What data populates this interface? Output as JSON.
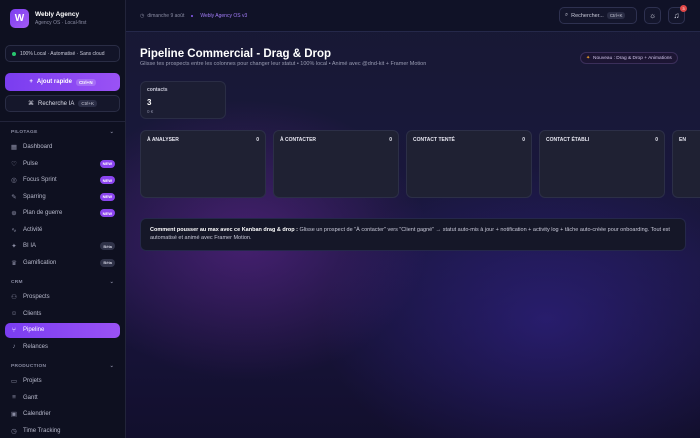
{
  "brand": {
    "name": "Webly Agency",
    "subtitle": "Agency OS · Local-first",
    "logo_letter": "W"
  },
  "local_badge": "100% Local · Automatisé · Sans cloud",
  "quick_add": {
    "label": "Ajout rapide",
    "shortcut": "Ctrl+N"
  },
  "ai_search": {
    "label": "Recherche IA",
    "shortcut": "Ctrl+K"
  },
  "sections": {
    "pilotage": "PILOTAGE",
    "crm": "CRM",
    "production": "PRODUCTION"
  },
  "nav": {
    "dashboard": "Dashboard",
    "pulse": "Pulse",
    "focus_sprint": "Focus Sprint",
    "sparring": "Sparring",
    "plan_de_guerre": "Plan de guerre",
    "activite": "Activité",
    "bi_ia": "BI IA",
    "gamification": "Gamification",
    "prospects": "Prospects",
    "clients": "Clients",
    "pipeline": "Pipeline",
    "relances": "Relances",
    "projets": "Projets",
    "gantt": "Gantt",
    "calendrier": "Calendrier",
    "time_tracking": "Time Tracking"
  },
  "tags": {
    "new": "NEW",
    "beta": "Bêta"
  },
  "topbar": {
    "date": "dimanche 9 août",
    "version": "Webly Agency OS v3",
    "search_label": "Rechercher...",
    "search_shortcut": "Ctrl+K",
    "notification_count": "3"
  },
  "page": {
    "title": "Pipeline Commercial - Drag & Drop",
    "subtitle": "Glisse tes prospects entre les colonnes pour changer leur statut • 100% local • Animé avec @dnd-kit + Framer Motion",
    "badge": "Nouveau : Drag & Drop + Animations"
  },
  "stat": {
    "label": "contacts",
    "value": "3",
    "amount": "0 €"
  },
  "columns": [
    {
      "title": "À ANALYSER",
      "count": "0"
    },
    {
      "title": "À CONTACTER",
      "count": "0"
    },
    {
      "title": "CONTACT TENTÉ",
      "count": "0"
    },
    {
      "title": "CONTACT ÉTABLI",
      "count": "0"
    },
    {
      "title": "EN",
      "count": ""
    }
  ],
  "tip": {
    "bold": "Comment pousser au max avec ce Kanban drag & drop :",
    "text": " Glisse un prospect de \"À contacter\" vers \"Client gagné\" → statut auto-mis à jour + notification + activity log + tâche auto-créée pour onboarding. Tout est automatisé et animé avec Framer Motion."
  }
}
